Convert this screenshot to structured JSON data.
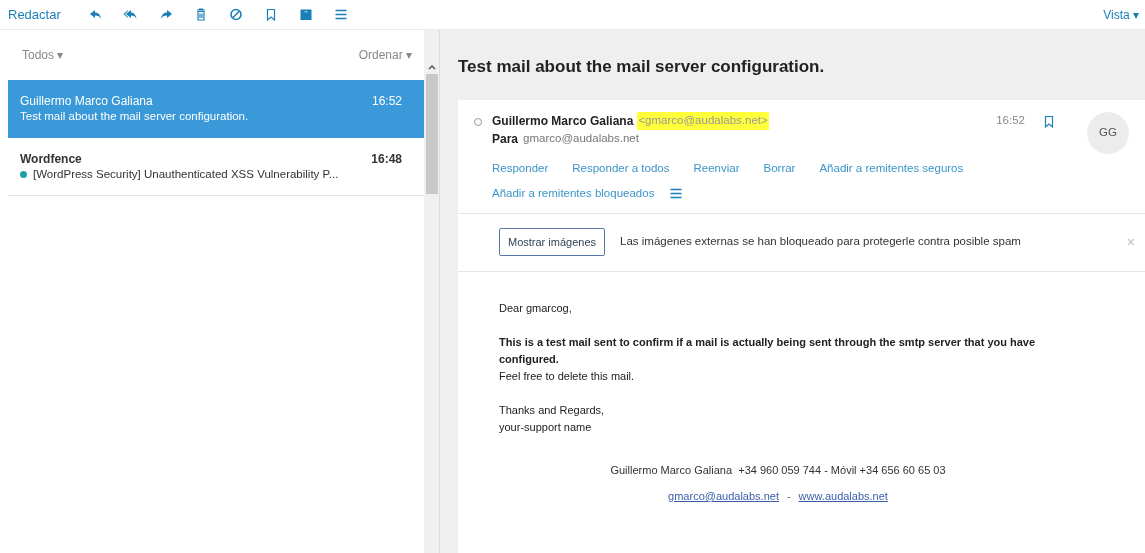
{
  "toolbar": {
    "compose": "Redactar",
    "icons": [
      {
        "kind": "reply"
      },
      {
        "kind": "reply-all"
      },
      {
        "kind": "forward"
      },
      {
        "kind": "trash"
      },
      {
        "kind": "block"
      },
      {
        "kind": "bookmark"
      },
      {
        "kind": "archive"
      },
      {
        "kind": "menu"
      }
    ],
    "view": "Vista ▾"
  },
  "list_header": {
    "filter": "Todos ▾",
    "sort": "Ordenar ▾"
  },
  "messages": [
    {
      "sender": "Guillermo Marco Galiana",
      "time": "16:52",
      "subject": "Test mail about the mail server configuration.",
      "selected": true,
      "unread": false
    },
    {
      "sender": "Wordfence",
      "time": "16:48",
      "subject": "[WordPress Security] Unauthenticated XSS Vulnerability P...",
      "selected": false,
      "unread": true
    }
  ],
  "message": {
    "title": "Test mail about the mail server configuration.",
    "from_name": "Guillermo Marco Galiana",
    "from_address": "<gmarco@audalabs.net>",
    "address_highlighted": true,
    "to_label": "Para",
    "to": "gmarco@audalabs.net",
    "time": "16:52",
    "avatar": "GG",
    "actions": [
      "Responder",
      "Responder a todos",
      "Reenviar",
      "Borrar",
      "Añadir a remitentes seguros",
      "Añadir a remitentes bloqueados"
    ],
    "images_button": "Mostrar imágenes",
    "images_notice": "Las imágenes externas se han bloqueado para protegerle contra posible spam",
    "close": "×",
    "body": [
      {
        "lines": [
          {
            "text": "Dear gmarcog,",
            "bold": false
          }
        ]
      },
      {
        "lines": [
          {
            "text": "This is a test mail sent to confirm if a mail is actually being sent through the smtp server that you have configured.",
            "bold": true
          },
          {
            "text": "Feel free to delete this mail.",
            "bold": false
          }
        ]
      },
      {
        "lines": [
          {
            "text": "Thanks and Regards,",
            "bold": false
          },
          {
            "text": "your-support name",
            "bold": false
          }
        ]
      }
    ],
    "signature": "Guillermo Marco Galiana  +34 960 059 744 - Móvil +34 656 60 65 03",
    "links": [
      "gmarco@audalabs.net",
      "www.audalabs.net"
    ],
    "link_separator": "-"
  }
}
